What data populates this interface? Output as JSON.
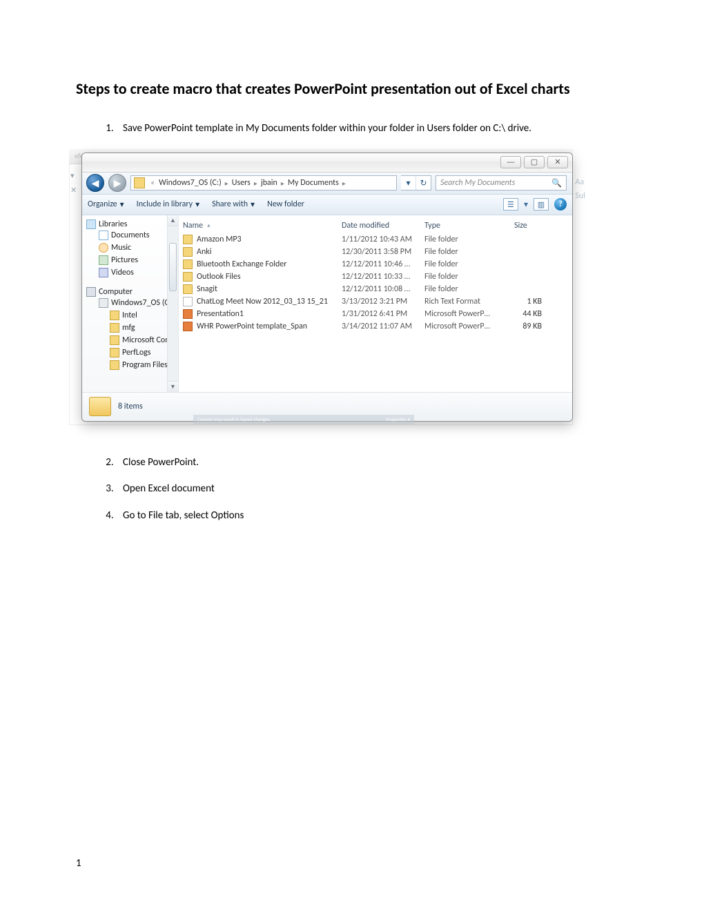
{
  "doc": {
    "title": "Steps to create macro that creates PowerPoint presentation out of Excel charts",
    "steps": [
      "Save PowerPoint template in My Documents folder within your folder in Users folder on C:\\ drive.",
      "Close PowerPoint.",
      "Open Excel document",
      "Go to File tab, select Options"
    ],
    "page_number": "1"
  },
  "bg": {
    "ghost_tab": "efe",
    "right_letters_top": "Aa",
    "right_letters_bot": "Sul",
    "left_x": "✕",
    "left_dd": "▾"
  },
  "win": {
    "minimize": "—",
    "maximize": "▢",
    "close": "✕"
  },
  "addr": {
    "chev": "«",
    "crumbs": [
      "Windows7_OS (C:)",
      "Users",
      "jbain",
      "My Documents"
    ],
    "sep": "▸",
    "dd": "▾",
    "refresh": "↻",
    "search_placeholder": "Search My Documents",
    "search_icon": "🔍"
  },
  "toolbar": {
    "organize": "Organize",
    "include": "Include in library",
    "share": "Share with",
    "newfolder": "New folder",
    "dd": "▾",
    "view_glyph": "☰",
    "preview_glyph": "▥",
    "help_glyph": "?"
  },
  "cols": {
    "name": "Name",
    "date": "Date modified",
    "type": "Type",
    "size": "Size"
  },
  "nav": {
    "libraries": "Libraries",
    "documents": "Documents",
    "music": "Music",
    "pictures": "Pictures",
    "videos": "Videos",
    "computer": "Computer",
    "drive": "Windows7_OS (C",
    "sub": [
      "Intel",
      "mfg",
      "Microsoft Com",
      "PerfLogs",
      "Program Files"
    ]
  },
  "files": [
    {
      "name": "Amazon MP3",
      "date": "1/11/2012 10:43 AM",
      "type": "File folder",
      "size": "",
      "icon": "folder"
    },
    {
      "name": "Anki",
      "date": "12/30/2011 3:58 PM",
      "type": "File folder",
      "size": "",
      "icon": "folder"
    },
    {
      "name": "Bluetooth Exchange Folder",
      "date": "12/12/2011 10:46 …",
      "type": "File folder",
      "size": "",
      "icon": "folder"
    },
    {
      "name": "Outlook Files",
      "date": "12/12/2011 10:33 …",
      "type": "File folder",
      "size": "",
      "icon": "folder"
    },
    {
      "name": "Snagit",
      "date": "12/12/2011 10:08 …",
      "type": "File folder",
      "size": "",
      "icon": "folder"
    },
    {
      "name": "ChatLog Meet Now 2012_03_13 15_21",
      "date": "3/13/2012 3:21 PM",
      "type": "Rich Text Format",
      "size": "1 KB",
      "icon": "rtf"
    },
    {
      "name": "Presentation1",
      "date": "1/31/2012 6:41 PM",
      "type": "Microsoft PowerP…",
      "size": "44 KB",
      "icon": "ppt"
    },
    {
      "name": "WHR PowerPoint template_Span",
      "date": "3/14/2012 11:07 AM",
      "type": "Microsoft PowerP…",
      "size": "89 KB",
      "icon": "ppt"
    }
  ],
  "status": {
    "text": "8 items"
  },
  "ghostbar": {
    "left": "Convert    may result in layout changes.",
    "right": "Properties ▾"
  }
}
